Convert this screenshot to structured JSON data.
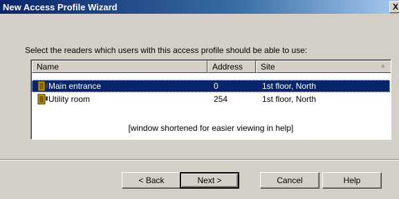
{
  "window": {
    "title": "New Access Profile Wizard",
    "close_label": "X"
  },
  "instruction": "Select the readers which users with this access profile should be able to use:",
  "list": {
    "columns": {
      "name": "Name",
      "address": "Address",
      "site": "Site"
    },
    "rows": [
      {
        "name": "Main entrance",
        "address": "0",
        "site": "1st floor, North",
        "selected": true
      },
      {
        "name": "Utility room",
        "address": "254",
        "site": "1st floor, North",
        "selected": false
      }
    ],
    "note": "[window shortened for easier viewing in help]"
  },
  "buttons": {
    "back": "< Back",
    "next": "Next >",
    "cancel": "Cancel",
    "help": "Help"
  },
  "icons": {
    "reader": "door-reader-icon",
    "sort": "sort-arrow-icon"
  },
  "colors": {
    "selection": "#0a246a",
    "titlebar": "#0a246a",
    "face": "#d4d0c8"
  }
}
